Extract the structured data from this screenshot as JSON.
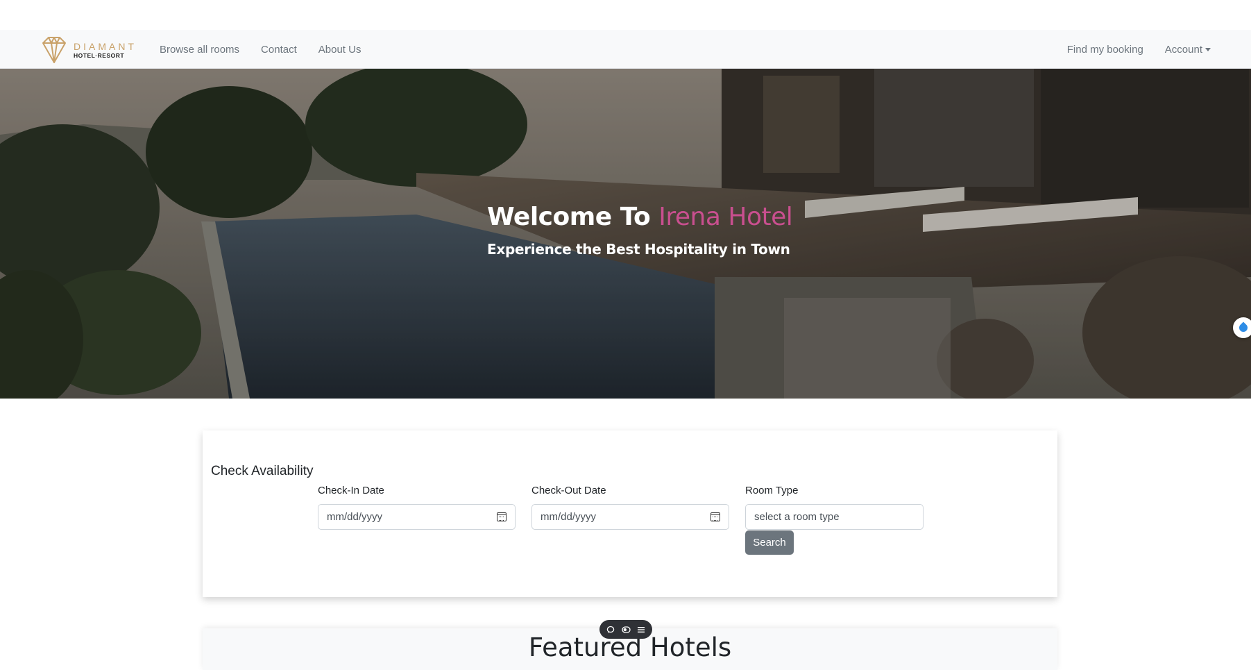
{
  "brand": {
    "name": "DIAMANT",
    "subtitle": "HOTEL·RESORT"
  },
  "nav": {
    "left": [
      "Browse all rooms",
      "Contact",
      "About Us"
    ],
    "find_booking": "Find my booking",
    "account": "Account"
  },
  "hero": {
    "title_prefix": "Welcome To",
    "title_accent": "Irena Hotel",
    "subtitle": "Experience the Best Hospitality in Town"
  },
  "availability": {
    "title": "Check Availability",
    "check_in_label": "Check-In Date",
    "check_in_placeholder": "mm/dd/yyyy",
    "check_out_label": "Check-Out Date",
    "check_out_placeholder": "mm/dd/yyyy",
    "room_type_label": "Room Type",
    "room_type_placeholder": "select a room type",
    "search_label": "Search"
  },
  "featured": {
    "title": "Featured Hotels"
  },
  "colors": {
    "accent": "#c94f8f",
    "brand_gold": "#c9a26a",
    "button_gray": "#6c757d",
    "navbar_bg": "#f8f9fa"
  },
  "icons": {
    "logo": "diamond-logo-icon",
    "date": "calendar-icon",
    "widget": "water-drop-icon",
    "toolbar": [
      "chat-icon",
      "toggle-icon",
      "menu-icon"
    ]
  }
}
